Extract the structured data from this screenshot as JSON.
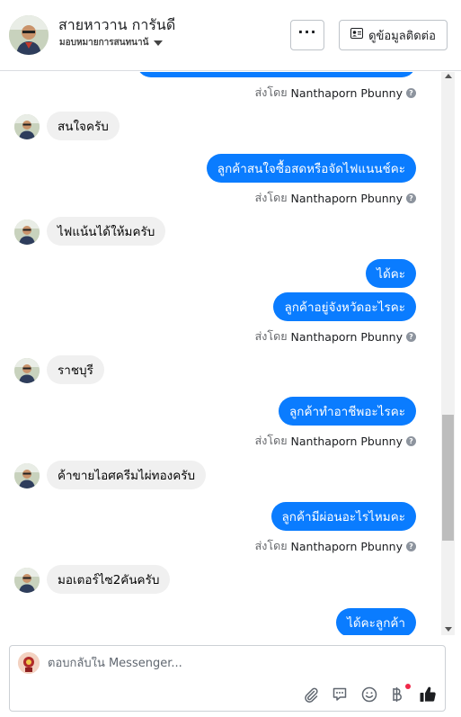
{
  "header": {
    "name": "สายหาวาน การันดี",
    "subtitle": "มอบหมายการสนทนาน้",
    "more_label": "···",
    "info_label": "ดูข้อมูลติดต่อ"
  },
  "sent_by": {
    "prefix": "ส่งโดย",
    "author": "Nanthaporn Pbunny"
  },
  "messages": [
    {
      "direction": "in",
      "text": "สนใจครับ"
    },
    {
      "direction": "out",
      "text": "ลูกค้าสนใจซื้อสดหรือจัดไฟแนนช์คะ"
    },
    {
      "direction": "in",
      "text": "ไฟแน้นได้ให้มครับ"
    },
    {
      "direction": "out",
      "text": "ได้คะ"
    },
    {
      "direction": "out",
      "text": "ลูกค้าอยู่จังหวัดอะไรคะ"
    },
    {
      "direction": "in",
      "text": "ราชบุรี"
    },
    {
      "direction": "out",
      "text": "ลูกค้าทำอาชีพอะไรคะ"
    },
    {
      "direction": "in",
      "text": "ค้าขายไอศครีมไผ่ทองครับ"
    },
    {
      "direction": "out",
      "text": "ลูกค้ามีผ่อนอะไรไหมคะ"
    },
    {
      "direction": "in",
      "text": "มอเตอร์ไซ2คันครับ"
    },
    {
      "direction": "out",
      "text": "ได้คะลูกค้า"
    }
  ],
  "composer": {
    "placeholder": "ตอบกลับใน Messenger..."
  },
  "icons": {
    "attach": "paperclip-icon",
    "sticker": "sticker-icon",
    "emoji": "emoji-icon",
    "payment": "baht-icon",
    "like": "thumbs-up-icon"
  },
  "colors": {
    "outgoing_bubble": "#0a7cff",
    "incoming_bubble": "#f0f0f0",
    "like": "#1c1e21",
    "notification_dot": "#f02849"
  }
}
